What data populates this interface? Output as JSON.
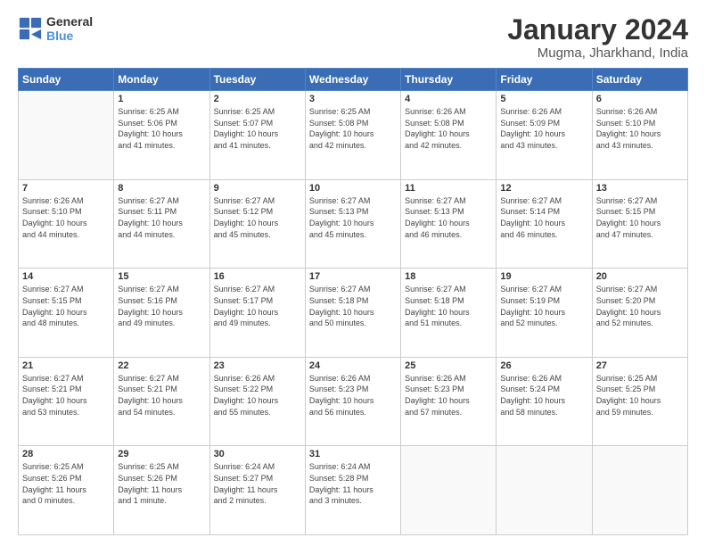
{
  "logo": {
    "line1": "General",
    "line2": "Blue"
  },
  "title": "January 2024",
  "subtitle": "Mugma, Jharkhand, India",
  "days_header": [
    "Sunday",
    "Monday",
    "Tuesday",
    "Wednesday",
    "Thursday",
    "Friday",
    "Saturday"
  ],
  "weeks": [
    [
      {
        "num": "",
        "info": ""
      },
      {
        "num": "1",
        "info": "Sunrise: 6:25 AM\nSunset: 5:06 PM\nDaylight: 10 hours\nand 41 minutes."
      },
      {
        "num": "2",
        "info": "Sunrise: 6:25 AM\nSunset: 5:07 PM\nDaylight: 10 hours\nand 41 minutes."
      },
      {
        "num": "3",
        "info": "Sunrise: 6:25 AM\nSunset: 5:08 PM\nDaylight: 10 hours\nand 42 minutes."
      },
      {
        "num": "4",
        "info": "Sunrise: 6:26 AM\nSunset: 5:08 PM\nDaylight: 10 hours\nand 42 minutes."
      },
      {
        "num": "5",
        "info": "Sunrise: 6:26 AM\nSunset: 5:09 PM\nDaylight: 10 hours\nand 43 minutes."
      },
      {
        "num": "6",
        "info": "Sunrise: 6:26 AM\nSunset: 5:10 PM\nDaylight: 10 hours\nand 43 minutes."
      }
    ],
    [
      {
        "num": "7",
        "info": "Sunrise: 6:26 AM\nSunset: 5:10 PM\nDaylight: 10 hours\nand 44 minutes."
      },
      {
        "num": "8",
        "info": "Sunrise: 6:27 AM\nSunset: 5:11 PM\nDaylight: 10 hours\nand 44 minutes."
      },
      {
        "num": "9",
        "info": "Sunrise: 6:27 AM\nSunset: 5:12 PM\nDaylight: 10 hours\nand 45 minutes."
      },
      {
        "num": "10",
        "info": "Sunrise: 6:27 AM\nSunset: 5:13 PM\nDaylight: 10 hours\nand 45 minutes."
      },
      {
        "num": "11",
        "info": "Sunrise: 6:27 AM\nSunset: 5:13 PM\nDaylight: 10 hours\nand 46 minutes."
      },
      {
        "num": "12",
        "info": "Sunrise: 6:27 AM\nSunset: 5:14 PM\nDaylight: 10 hours\nand 46 minutes."
      },
      {
        "num": "13",
        "info": "Sunrise: 6:27 AM\nSunset: 5:15 PM\nDaylight: 10 hours\nand 47 minutes."
      }
    ],
    [
      {
        "num": "14",
        "info": "Sunrise: 6:27 AM\nSunset: 5:15 PM\nDaylight: 10 hours\nand 48 minutes."
      },
      {
        "num": "15",
        "info": "Sunrise: 6:27 AM\nSunset: 5:16 PM\nDaylight: 10 hours\nand 49 minutes."
      },
      {
        "num": "16",
        "info": "Sunrise: 6:27 AM\nSunset: 5:17 PM\nDaylight: 10 hours\nand 49 minutes."
      },
      {
        "num": "17",
        "info": "Sunrise: 6:27 AM\nSunset: 5:18 PM\nDaylight: 10 hours\nand 50 minutes."
      },
      {
        "num": "18",
        "info": "Sunrise: 6:27 AM\nSunset: 5:18 PM\nDaylight: 10 hours\nand 51 minutes."
      },
      {
        "num": "19",
        "info": "Sunrise: 6:27 AM\nSunset: 5:19 PM\nDaylight: 10 hours\nand 52 minutes."
      },
      {
        "num": "20",
        "info": "Sunrise: 6:27 AM\nSunset: 5:20 PM\nDaylight: 10 hours\nand 52 minutes."
      }
    ],
    [
      {
        "num": "21",
        "info": "Sunrise: 6:27 AM\nSunset: 5:21 PM\nDaylight: 10 hours\nand 53 minutes."
      },
      {
        "num": "22",
        "info": "Sunrise: 6:27 AM\nSunset: 5:21 PM\nDaylight: 10 hours\nand 54 minutes."
      },
      {
        "num": "23",
        "info": "Sunrise: 6:26 AM\nSunset: 5:22 PM\nDaylight: 10 hours\nand 55 minutes."
      },
      {
        "num": "24",
        "info": "Sunrise: 6:26 AM\nSunset: 5:23 PM\nDaylight: 10 hours\nand 56 minutes."
      },
      {
        "num": "25",
        "info": "Sunrise: 6:26 AM\nSunset: 5:23 PM\nDaylight: 10 hours\nand 57 minutes."
      },
      {
        "num": "26",
        "info": "Sunrise: 6:26 AM\nSunset: 5:24 PM\nDaylight: 10 hours\nand 58 minutes."
      },
      {
        "num": "27",
        "info": "Sunrise: 6:25 AM\nSunset: 5:25 PM\nDaylight: 10 hours\nand 59 minutes."
      }
    ],
    [
      {
        "num": "28",
        "info": "Sunrise: 6:25 AM\nSunset: 5:26 PM\nDaylight: 11 hours\nand 0 minutes."
      },
      {
        "num": "29",
        "info": "Sunrise: 6:25 AM\nSunset: 5:26 PM\nDaylight: 11 hours\nand 1 minute."
      },
      {
        "num": "30",
        "info": "Sunrise: 6:24 AM\nSunset: 5:27 PM\nDaylight: 11 hours\nand 2 minutes."
      },
      {
        "num": "31",
        "info": "Sunrise: 6:24 AM\nSunset: 5:28 PM\nDaylight: 11 hours\nand 3 minutes."
      },
      {
        "num": "",
        "info": ""
      },
      {
        "num": "",
        "info": ""
      },
      {
        "num": "",
        "info": ""
      }
    ]
  ]
}
